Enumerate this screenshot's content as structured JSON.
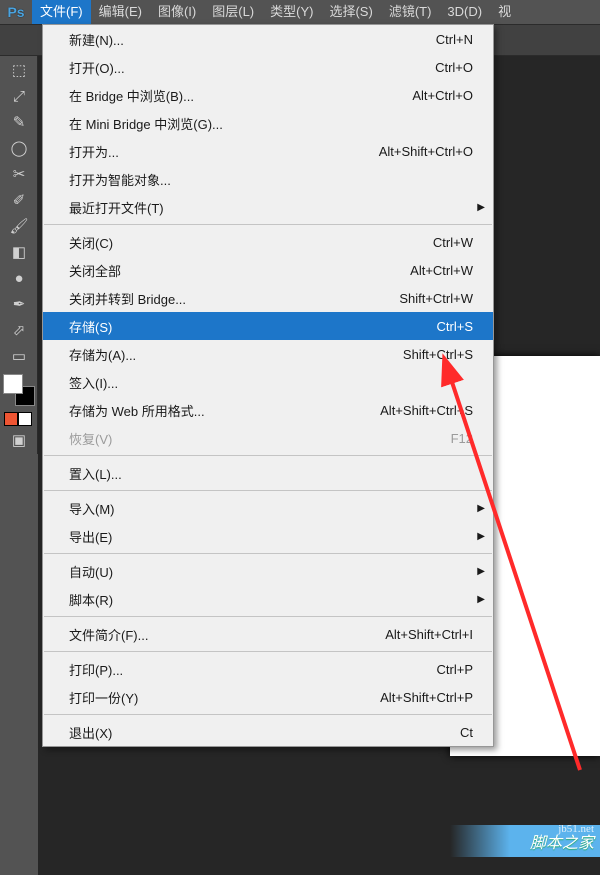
{
  "app_icon_text": "Ps",
  "menubar": [
    {
      "label": "文件(F)",
      "active": true
    },
    {
      "label": "编辑(E)"
    },
    {
      "label": "图像(I)"
    },
    {
      "label": "图层(L)"
    },
    {
      "label": "类型(Y)"
    },
    {
      "label": "选择(S)"
    },
    {
      "label": "滤镜(T)"
    },
    {
      "label": "3D(D)"
    },
    {
      "label": "视"
    }
  ],
  "tools": [
    {
      "glyph": "⬚",
      "name": "marquee"
    },
    {
      "glyph": "⤢",
      "name": "move"
    },
    {
      "glyph": "✎",
      "name": "pencil-dotted"
    },
    {
      "glyph": "◯",
      "name": "lasso"
    },
    {
      "glyph": "✂",
      "name": "crop"
    },
    {
      "glyph": "✐",
      "name": "brush"
    },
    {
      "glyph": "🖌",
      "name": "stamp"
    },
    {
      "glyph": "◧",
      "name": "eraser"
    },
    {
      "glyph": "●",
      "name": "dodge"
    },
    {
      "glyph": "✒",
      "name": "pen"
    },
    {
      "glyph": "⬀",
      "name": "path-select"
    },
    {
      "glyph": "▭",
      "name": "shape"
    }
  ],
  "dropdown": [
    [
      {
        "label": "新建(N)...",
        "shortcut": "Ctrl+N"
      },
      {
        "label": "打开(O)...",
        "shortcut": "Ctrl+O"
      },
      {
        "label": "在 Bridge 中浏览(B)...",
        "shortcut": "Alt+Ctrl+O"
      },
      {
        "label": "在 Mini Bridge 中浏览(G)..."
      },
      {
        "label": "打开为...",
        "shortcut": "Alt+Shift+Ctrl+O"
      },
      {
        "label": "打开为智能对象..."
      },
      {
        "label": "最近打开文件(T)",
        "submenu": true
      }
    ],
    [
      {
        "label": "关闭(C)",
        "shortcut": "Ctrl+W"
      },
      {
        "label": "关闭全部",
        "shortcut": "Alt+Ctrl+W"
      },
      {
        "label": "关闭并转到 Bridge...",
        "shortcut": "Shift+Ctrl+W"
      },
      {
        "label": "存储(S)",
        "shortcut": "Ctrl+S",
        "selected": true
      },
      {
        "label": "存储为(A)...",
        "shortcut": "Shift+Ctrl+S"
      },
      {
        "label": "签入(I)..."
      },
      {
        "label": "存储为 Web 所用格式...",
        "shortcut": "Alt+Shift+Ctrl+S"
      },
      {
        "label": "恢复(V)",
        "shortcut": "F12",
        "disabled": true
      }
    ],
    [
      {
        "label": "置入(L)..."
      }
    ],
    [
      {
        "label": "导入(M)",
        "submenu": true
      },
      {
        "label": "导出(E)",
        "submenu": true
      }
    ],
    [
      {
        "label": "自动(U)",
        "submenu": true
      },
      {
        "label": "脚本(R)",
        "submenu": true
      }
    ],
    [
      {
        "label": "文件简介(F)...",
        "shortcut": "Alt+Shift+Ctrl+I"
      }
    ],
    [
      {
        "label": "打印(P)...",
        "shortcut": "Ctrl+P"
      },
      {
        "label": "打印一份(Y)",
        "shortcut": "Alt+Shift+Ctrl+P"
      }
    ],
    [
      {
        "label": "退出(X)",
        "shortcut": "Ct"
      }
    ]
  ],
  "watermark": {
    "url": "jb51.net",
    "zh": "脚本之家"
  }
}
